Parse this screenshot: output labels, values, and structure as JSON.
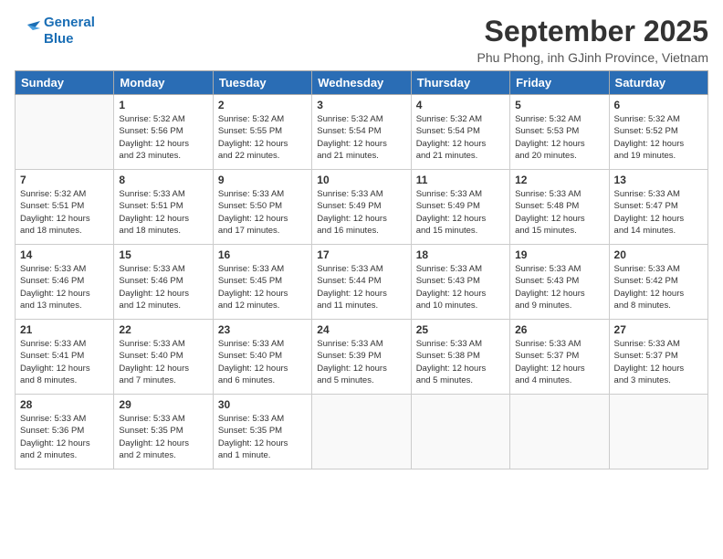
{
  "logo": {
    "line1": "General",
    "line2": "Blue"
  },
  "title": "September 2025",
  "location": "Phu Phong, inh GJinh Province, Vietnam",
  "header": {
    "days": [
      "Sunday",
      "Monday",
      "Tuesday",
      "Wednesday",
      "Thursday",
      "Friday",
      "Saturday"
    ]
  },
  "weeks": [
    [
      {
        "day": "",
        "info": ""
      },
      {
        "day": "1",
        "info": "Sunrise: 5:32 AM\nSunset: 5:56 PM\nDaylight: 12 hours\nand 23 minutes."
      },
      {
        "day": "2",
        "info": "Sunrise: 5:32 AM\nSunset: 5:55 PM\nDaylight: 12 hours\nand 22 minutes."
      },
      {
        "day": "3",
        "info": "Sunrise: 5:32 AM\nSunset: 5:54 PM\nDaylight: 12 hours\nand 21 minutes."
      },
      {
        "day": "4",
        "info": "Sunrise: 5:32 AM\nSunset: 5:54 PM\nDaylight: 12 hours\nand 21 minutes."
      },
      {
        "day": "5",
        "info": "Sunrise: 5:32 AM\nSunset: 5:53 PM\nDaylight: 12 hours\nand 20 minutes."
      },
      {
        "day": "6",
        "info": "Sunrise: 5:32 AM\nSunset: 5:52 PM\nDaylight: 12 hours\nand 19 minutes."
      }
    ],
    [
      {
        "day": "7",
        "info": "Sunrise: 5:32 AM\nSunset: 5:51 PM\nDaylight: 12 hours\nand 18 minutes."
      },
      {
        "day": "8",
        "info": "Sunrise: 5:33 AM\nSunset: 5:51 PM\nDaylight: 12 hours\nand 18 minutes."
      },
      {
        "day": "9",
        "info": "Sunrise: 5:33 AM\nSunset: 5:50 PM\nDaylight: 12 hours\nand 17 minutes."
      },
      {
        "day": "10",
        "info": "Sunrise: 5:33 AM\nSunset: 5:49 PM\nDaylight: 12 hours\nand 16 minutes."
      },
      {
        "day": "11",
        "info": "Sunrise: 5:33 AM\nSunset: 5:49 PM\nDaylight: 12 hours\nand 15 minutes."
      },
      {
        "day": "12",
        "info": "Sunrise: 5:33 AM\nSunset: 5:48 PM\nDaylight: 12 hours\nand 15 minutes."
      },
      {
        "day": "13",
        "info": "Sunrise: 5:33 AM\nSunset: 5:47 PM\nDaylight: 12 hours\nand 14 minutes."
      }
    ],
    [
      {
        "day": "14",
        "info": "Sunrise: 5:33 AM\nSunset: 5:46 PM\nDaylight: 12 hours\nand 13 minutes."
      },
      {
        "day": "15",
        "info": "Sunrise: 5:33 AM\nSunset: 5:46 PM\nDaylight: 12 hours\nand 12 minutes."
      },
      {
        "day": "16",
        "info": "Sunrise: 5:33 AM\nSunset: 5:45 PM\nDaylight: 12 hours\nand 12 minutes."
      },
      {
        "day": "17",
        "info": "Sunrise: 5:33 AM\nSunset: 5:44 PM\nDaylight: 12 hours\nand 11 minutes."
      },
      {
        "day": "18",
        "info": "Sunrise: 5:33 AM\nSunset: 5:43 PM\nDaylight: 12 hours\nand 10 minutes."
      },
      {
        "day": "19",
        "info": "Sunrise: 5:33 AM\nSunset: 5:43 PM\nDaylight: 12 hours\nand 9 minutes."
      },
      {
        "day": "20",
        "info": "Sunrise: 5:33 AM\nSunset: 5:42 PM\nDaylight: 12 hours\nand 8 minutes."
      }
    ],
    [
      {
        "day": "21",
        "info": "Sunrise: 5:33 AM\nSunset: 5:41 PM\nDaylight: 12 hours\nand 8 minutes."
      },
      {
        "day": "22",
        "info": "Sunrise: 5:33 AM\nSunset: 5:40 PM\nDaylight: 12 hours\nand 7 minutes."
      },
      {
        "day": "23",
        "info": "Sunrise: 5:33 AM\nSunset: 5:40 PM\nDaylight: 12 hours\nand 6 minutes."
      },
      {
        "day": "24",
        "info": "Sunrise: 5:33 AM\nSunset: 5:39 PM\nDaylight: 12 hours\nand 5 minutes."
      },
      {
        "day": "25",
        "info": "Sunrise: 5:33 AM\nSunset: 5:38 PM\nDaylight: 12 hours\nand 5 minutes."
      },
      {
        "day": "26",
        "info": "Sunrise: 5:33 AM\nSunset: 5:37 PM\nDaylight: 12 hours\nand 4 minutes."
      },
      {
        "day": "27",
        "info": "Sunrise: 5:33 AM\nSunset: 5:37 PM\nDaylight: 12 hours\nand 3 minutes."
      }
    ],
    [
      {
        "day": "28",
        "info": "Sunrise: 5:33 AM\nSunset: 5:36 PM\nDaylight: 12 hours\nand 2 minutes."
      },
      {
        "day": "29",
        "info": "Sunrise: 5:33 AM\nSunset: 5:35 PM\nDaylight: 12 hours\nand 2 minutes."
      },
      {
        "day": "30",
        "info": "Sunrise: 5:33 AM\nSunset: 5:35 PM\nDaylight: 12 hours\nand 1 minute."
      },
      {
        "day": "",
        "info": ""
      },
      {
        "day": "",
        "info": ""
      },
      {
        "day": "",
        "info": ""
      },
      {
        "day": "",
        "info": ""
      }
    ]
  ]
}
